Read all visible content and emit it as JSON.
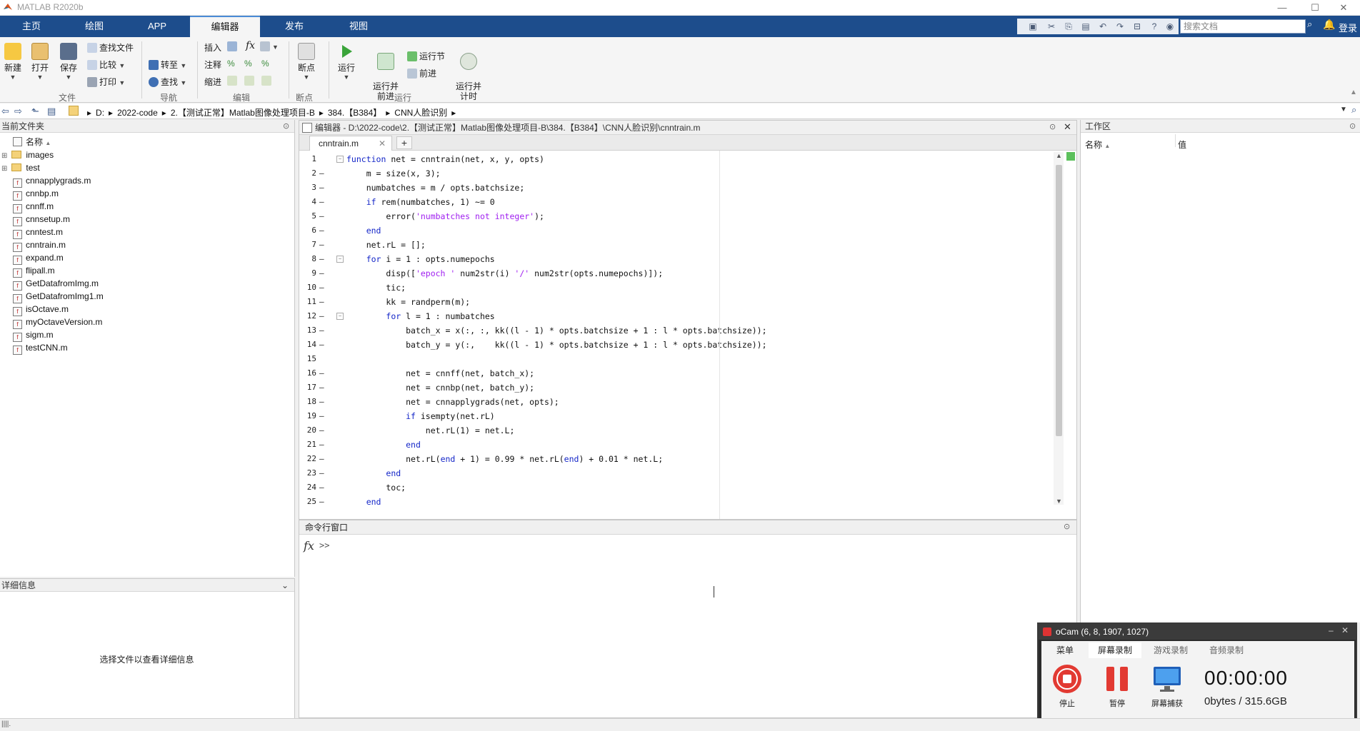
{
  "window": {
    "title": "MATLAB R2020b",
    "controls": [
      "—",
      "☐",
      "✕"
    ]
  },
  "tabs": [
    "主页",
    "绘图",
    "APP",
    "编辑器",
    "发布",
    "视图"
  ],
  "active_tab": "编辑器",
  "search": {
    "placeholder": "搜索文档"
  },
  "login_label": "登录",
  "ribbon": {
    "file": {
      "new": "新建",
      "open": "打开",
      "save": "保存",
      "find_files": "查找文件",
      "compare": "比较",
      "print": "打印",
      "group": "文件"
    },
    "navigate": {
      "goto": "转至",
      "find": "查找",
      "group": "导航"
    },
    "edit": {
      "insert": "插入",
      "fx": "fx",
      "comment": "注释",
      "indent": "缩进",
      "group": "编辑"
    },
    "breakpoints": {
      "breakpoints": "断点",
      "group": "断点"
    },
    "run": {
      "run": "运行",
      "run_advance": "运行并\n前进",
      "run_section": "运行节",
      "advance": "前进",
      "run_time": "运行并\n计时",
      "group": "运行"
    }
  },
  "address": {
    "crumbs": [
      "D:",
      "2022-code",
      "2.【测试正常】Matlab图像处理项目-B",
      "384.【B384】",
      "CNN人脸识别"
    ]
  },
  "current_folder": {
    "title": "当前文件夹",
    "name_header": "名称",
    "folders": [
      "images",
      "test"
    ],
    "files": [
      "cnnapplygrads.m",
      "cnnbp.m",
      "cnnff.m",
      "cnnsetup.m",
      "cnntest.m",
      "cnntrain.m",
      "expand.m",
      "flipall.m",
      "GetDatafromImg.m",
      "GetDatafromImg1.m",
      "isOctave.m",
      "myOctaveVersion.m",
      "sigm.m",
      "testCNN.m"
    ]
  },
  "details": {
    "title": "详细信息",
    "hint": "选择文件以查看详细信息"
  },
  "editor": {
    "header": "编辑器 - D:\\2022-code\\2.【测试正常】Matlab图像处理项目-B\\384.【B384】\\CNN人脸识别\\cnntrain.m",
    "tab": "cnntrain.m",
    "add_tab": "+",
    "lines": [
      {
        "n": "1",
        "d": "",
        "code": "function net = cnntrain(net, x, y, opts)"
      },
      {
        "n": "2",
        "d": "–",
        "code": "    m = size(x, 3);"
      },
      {
        "n": "3",
        "d": "–",
        "code": "    numbatches = m / opts.batchsize;"
      },
      {
        "n": "4",
        "d": "–",
        "code": "    if rem(numbatches, 1) ~= 0"
      },
      {
        "n": "5",
        "d": "–",
        "code": "        error('numbatches not integer');"
      },
      {
        "n": "6",
        "d": "–",
        "code": "    end"
      },
      {
        "n": "7",
        "d": "–",
        "code": "    net.rL = [];"
      },
      {
        "n": "8",
        "d": "–",
        "code": "    for i = 1 : opts.numepochs"
      },
      {
        "n": "9",
        "d": "–",
        "code": "        disp(['epoch ' num2str(i) '/' num2str(opts.numepochs)]);"
      },
      {
        "n": "10",
        "d": "–",
        "code": "        tic;"
      },
      {
        "n": "11",
        "d": "–",
        "code": "        kk = randperm(m);"
      },
      {
        "n": "12",
        "d": "–",
        "code": "        for l = 1 : numbatches"
      },
      {
        "n": "13",
        "d": "–",
        "code": "            batch_x = x(:, :, kk((l - 1) * opts.batchsize + 1 : l * opts.batchsize));"
      },
      {
        "n": "14",
        "d": "–",
        "code": "            batch_y = y(:,    kk((l - 1) * opts.batchsize + 1 : l * opts.batchsize));"
      },
      {
        "n": "15",
        "d": "",
        "code": ""
      },
      {
        "n": "16",
        "d": "–",
        "code": "            net = cnnff(net, batch_x);"
      },
      {
        "n": "17",
        "d": "–",
        "code": "            net = cnnbp(net, batch_y);"
      },
      {
        "n": "18",
        "d": "–",
        "code": "            net = cnnapplygrads(net, opts);"
      },
      {
        "n": "19",
        "d": "–",
        "code": "            if isempty(net.rL)"
      },
      {
        "n": "20",
        "d": "–",
        "code": "                net.rL(1) = net.L;"
      },
      {
        "n": "21",
        "d": "–",
        "code": "            end"
      },
      {
        "n": "22",
        "d": "–",
        "code": "            net.rL(end + 1) = 0.99 * net.rL(end) + 0.01 * net.L;"
      },
      {
        "n": "23",
        "d": "–",
        "code": "        end"
      },
      {
        "n": "24",
        "d": "–",
        "code": "        toc;"
      },
      {
        "n": "25",
        "d": "–",
        "code": "    end"
      }
    ]
  },
  "command_window": {
    "title": "命令行窗口",
    "fx": "fx",
    "prompt": ">>"
  },
  "workspace": {
    "title": "工作区",
    "name_header": "名称",
    "value_header": "值"
  },
  "ocam": {
    "title": "oCam (6, 8, 1907, 1027)",
    "tabs": [
      "菜单",
      "屏幕录制",
      "游戏录制",
      "音频录制"
    ],
    "active_tab": "屏幕录制",
    "stop": "停止",
    "pause": "暂停",
    "capture": "屏幕捕获",
    "timer": "00:00:00",
    "bytes": "0bytes / 315.6GB"
  },
  "colors": {
    "tabbar": "#1d4d8c",
    "keyword": "#1426c8",
    "string": "#a020f0",
    "stop_red": "#e23a32"
  }
}
